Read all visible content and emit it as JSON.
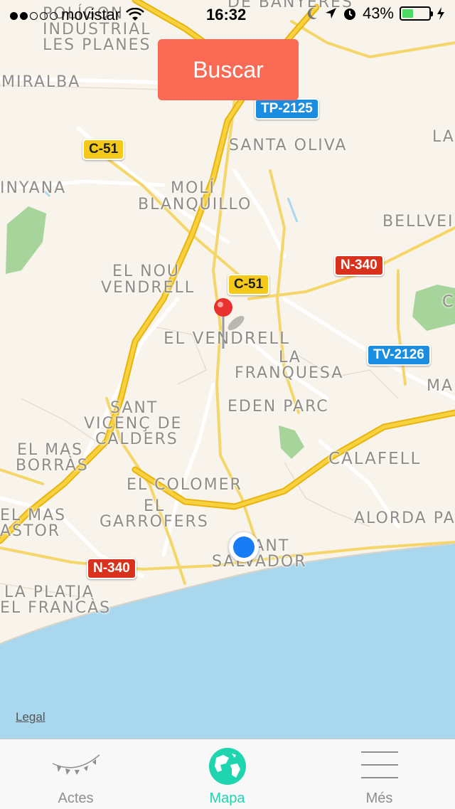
{
  "status_bar": {
    "carrier": "movistar",
    "time": "16:32",
    "battery": "43%",
    "battery_level": 0.43
  },
  "search_button": {
    "label": "Buscar"
  },
  "map": {
    "places": [
      {
        "name": "place-poligon",
        "text": "POLÍGON"
      },
      {
        "name": "place-industrial",
        "text": "INDUSTRIAL"
      },
      {
        "name": "place-les-planes",
        "text": "LES PLANES"
      },
      {
        "name": "place-banyeres",
        "text": "DE BANYERES"
      },
      {
        "name": "place-miralba",
        "text": "MIRALBA"
      },
      {
        "name": "place-santa-oliva",
        "text": "SANTA OLIVA"
      },
      {
        "name": "place-la-top",
        "text": "LA"
      },
      {
        "name": "place-inyana",
        "text": "INYANA"
      },
      {
        "name": "place-moli",
        "text": "MOLÍ"
      },
      {
        "name": "place-blanquillo",
        "text": "BLANQUILLO"
      },
      {
        "name": "place-bellvei",
        "text": "BELLVEI"
      },
      {
        "name": "place-el-nou",
        "text": "EL NOU"
      },
      {
        "name": "place-vendrell-nou",
        "text": "VENDRELL"
      },
      {
        "name": "place-el-vendrell",
        "text": "EL VENDRELL"
      },
      {
        "name": "place-la",
        "text": "LA"
      },
      {
        "name": "place-franquesa",
        "text": "FRANQUESA"
      },
      {
        "name": "place-ma",
        "text": "MA"
      },
      {
        "name": "place-eden-parc",
        "text": "EDEN PARC"
      },
      {
        "name": "place-sant",
        "text": "SANT"
      },
      {
        "name": "place-vicenc-de",
        "text": "VICENÇ DE"
      },
      {
        "name": "place-calders",
        "text": "CALDERS"
      },
      {
        "name": "place-calafell",
        "text": "CALAFELL"
      },
      {
        "name": "place-el-mas",
        "text": "EL MAS"
      },
      {
        "name": "place-borras",
        "text": "BORRÀS"
      },
      {
        "name": "place-el-colomer",
        "text": "EL COLOMER"
      },
      {
        "name": "place-el",
        "text": "EL"
      },
      {
        "name": "place-garrofers",
        "text": "GARROFERS"
      },
      {
        "name": "place-el-mas-2",
        "text": "EL MAS"
      },
      {
        "name": "place-astor",
        "text": "ASTOR"
      },
      {
        "name": "place-alorda",
        "text": "ALORDA PA"
      },
      {
        "name": "place-sant-2",
        "text": "SANT"
      },
      {
        "name": "place-salvador",
        "text": "SALVADOR"
      },
      {
        "name": "place-la-platja",
        "text": "LA PLATJA"
      },
      {
        "name": "place-el-francas",
        "text": "EL FRANCÀS"
      },
      {
        "name": "place-c-edge",
        "text": "C"
      }
    ],
    "shields": [
      {
        "name": "road-tp-2125",
        "text": "TP-2125",
        "color": "blue"
      },
      {
        "name": "road-c-51-north",
        "text": "C-51",
        "color": "yellow"
      },
      {
        "name": "road-c-51-center",
        "text": "C-51",
        "color": "yellow"
      },
      {
        "name": "road-n-340-east",
        "text": "N-340",
        "color": "red"
      },
      {
        "name": "road-tv-2126",
        "text": "TV-2126",
        "color": "blue"
      },
      {
        "name": "road-n-340-west",
        "text": "N-340",
        "color": "red"
      }
    ],
    "legal": "Legal"
  },
  "tabbar": {
    "tabs": [
      {
        "label": "Actes",
        "icon": "bunting-icon",
        "active": false
      },
      {
        "label": "Mapa",
        "icon": "globe-icon",
        "active": true
      },
      {
        "label": "Més",
        "icon": "menu-lines-icon",
        "active": false
      }
    ]
  },
  "colors": {
    "accent": "#1fd5b0",
    "button": "#fb6a55",
    "sea": "#a8d8ef",
    "highway": "#f2c61b",
    "user_location": "#1a7cf5",
    "pin": "#e8322f"
  }
}
